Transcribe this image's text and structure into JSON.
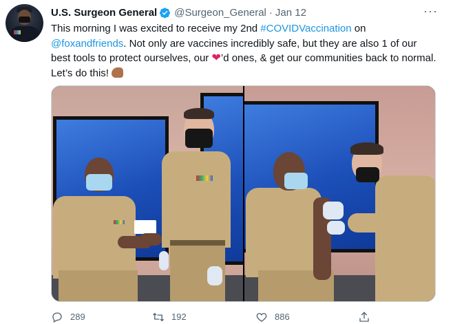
{
  "tweet": {
    "author_name": "U.S. Surgeon General",
    "handle": "@Surgeon_General",
    "separator": "·",
    "date": "Jan 12",
    "more": "···",
    "text": {
      "part1": "This morning I was excited to receive my 2nd ",
      "hashtag": "#COVIDVaccination",
      "part2": " on ",
      "mention": "@foxandfriends",
      "part3": ". Not only are vaccines incredibly safe, but they are also 1 of our best tools to protect ourselves, our ",
      "heart": "❤",
      "part4": "’d ones, & get our communities back to normal. Let’s do this! "
    },
    "emoji": [
      "red-heart",
      "flexed-biceps"
    ]
  },
  "actions": {
    "replies": "289",
    "retweets": "192",
    "likes": "886"
  },
  "colors": {
    "link": "#1b95e0",
    "verified": "#1da1f2",
    "muted": "#536471",
    "heart": "#e0245e"
  },
  "icons": [
    "verified-badge-icon",
    "more-icon",
    "reply-icon",
    "retweet-icon",
    "like-icon",
    "share-icon"
  ]
}
